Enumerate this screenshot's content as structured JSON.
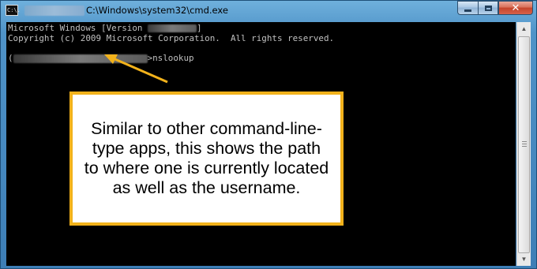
{
  "window": {
    "title": "C:\\Windows\\system32\\cmd.exe",
    "icon": "cmd-icon",
    "icon_text": "C:\\.",
    "minimize_icon": "minimize-icon",
    "maximize_icon": "maximize-icon",
    "close_label": "✕"
  },
  "console": {
    "line1_prefix": "Microsoft Windows [Version ",
    "line1_suffix": "]",
    "line2": "Copyright (c) 2009 Microsoft Corporation.  All rights reserved.",
    "prompt_open": "(",
    "prompt_suffix": ">",
    "command": "nslookup"
  },
  "scrollbar": {
    "up_icon": "▲",
    "down_icon": "▼"
  },
  "callout": {
    "text": "Similar to other command-line-type apps, this shows the path to where one is currently located as well as the username.",
    "border_color": "#f2b21b"
  },
  "colors": {
    "console_bg": "#000000",
    "console_fg": "#c0c0c0",
    "arrow": "#f2b21b"
  }
}
